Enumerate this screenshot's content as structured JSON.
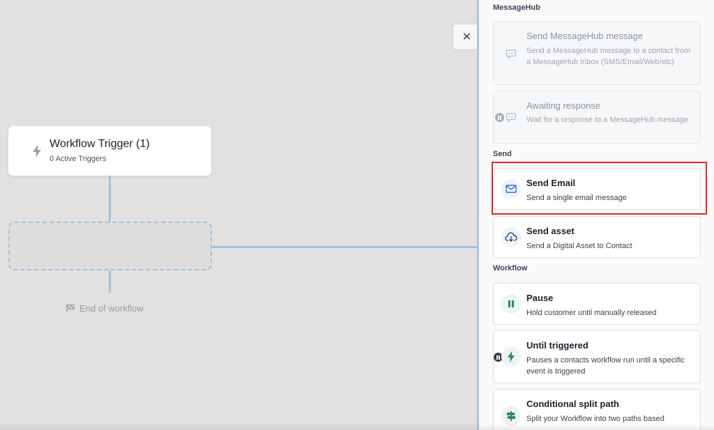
{
  "canvas": {
    "trigger": {
      "title": "Workflow Trigger (1)",
      "subtitle": "0 Active Triggers"
    },
    "end_label": "End of workflow",
    "close_symbol": "✕"
  },
  "panel": {
    "sections": {
      "messagehub": "MessageHub",
      "send": "Send",
      "workflow": "Workflow"
    },
    "cards": {
      "send_messagehub": {
        "title": "Send MessageHub message",
        "description": "Send a MessageHub message to a contact from a MessageHub Inbox (SMS/Email/Web/etc)",
        "icon": "chat-bubble-icon"
      },
      "awaiting_response": {
        "title": "Awaiting response",
        "description": "Wait for a response to a MessageHub message",
        "icon": "chat-bubble-icon"
      },
      "send_email": {
        "title": "Send Email",
        "description": "Send a single email message",
        "icon": "envelope-icon"
      },
      "send_asset": {
        "title": "Send asset",
        "description": "Send a Digital Asset to Contact",
        "icon": "cloud-download-icon"
      },
      "pause": {
        "title": "Pause",
        "description": "Hold customer until manually released",
        "icon": "pause-icon"
      },
      "until_triggered": {
        "title": "Until triggered",
        "description": "Pauses a contacts workflow run until a specific event is triggered",
        "icon": "lightning-icon"
      },
      "conditional_split": {
        "title": "Conditional split path",
        "description": "Split your Workflow into two paths based",
        "icon": "signpost-icon"
      }
    }
  },
  "colors": {
    "canvas_bg": "#e3e1df",
    "connector": "#9fc0de",
    "highlight": "#e0262a",
    "email_icon": "#2d6fd1",
    "pause_icon": "#2e8b57"
  }
}
